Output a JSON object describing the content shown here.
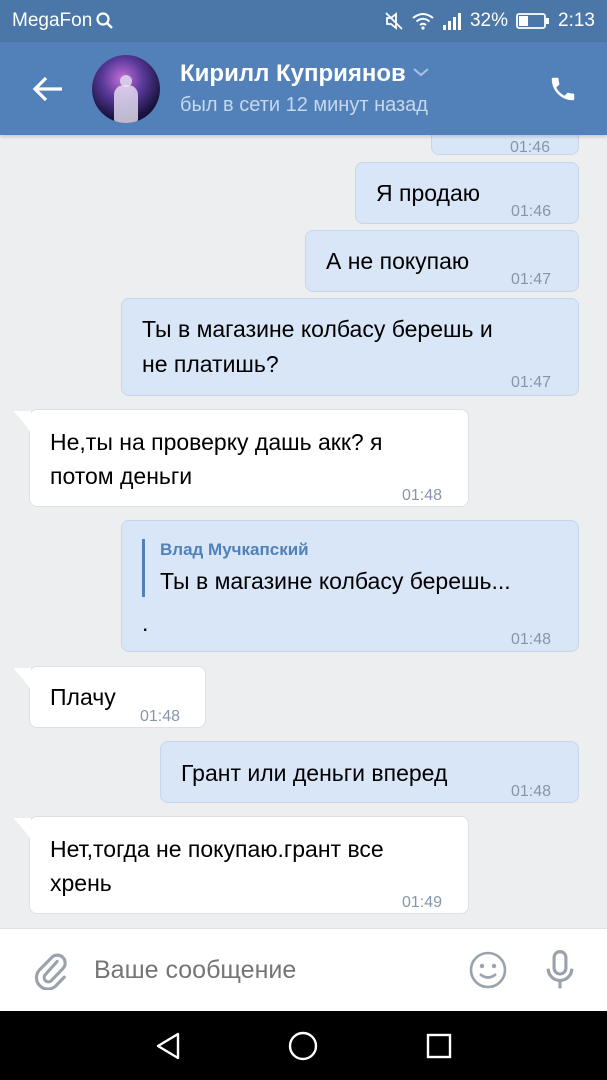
{
  "statusbar": {
    "carrier": "MegaFon",
    "battery": "32%",
    "time": "2:13"
  },
  "header": {
    "name": "Кирилл Куприянов",
    "status": "был в сети 12 минут назад"
  },
  "messages": [
    {
      "dir": "out",
      "text": "01:46",
      "partial": true
    },
    {
      "dir": "out",
      "text": "Я продаю",
      "time": "01:46"
    },
    {
      "dir": "out",
      "text": "А не покупаю",
      "time": "01:47"
    },
    {
      "dir": "out",
      "line1": "Ты в магазине колбасу берешь и",
      "line2": "не платишь?",
      "time": "01:47"
    },
    {
      "dir": "in",
      "line1": "Не,ты на проверку дашь акк? я",
      "line2": "потом деньги",
      "time": "01:48"
    },
    {
      "dir": "out",
      "reply_author": "Влад Мучкапский",
      "reply_text": "Ты в магазине колбасу берешь...",
      "text": ".",
      "time": "01:48"
    },
    {
      "dir": "in",
      "text": "Плачу",
      "time": "01:48"
    },
    {
      "dir": "out",
      "text": "Грант или деньги вперед",
      "time": "01:48"
    },
    {
      "dir": "in",
      "line1": "Нет,тогда не покупаю.грант все",
      "line2": "хрень",
      "time": "01:49"
    }
  ],
  "composer": {
    "placeholder": "Ваше сообщение"
  },
  "colors": {
    "header": "#5181b8",
    "out_bubble": "#d9e6f7",
    "in_bubble": "#ffffff",
    "chat_bg": "#edeef0"
  }
}
